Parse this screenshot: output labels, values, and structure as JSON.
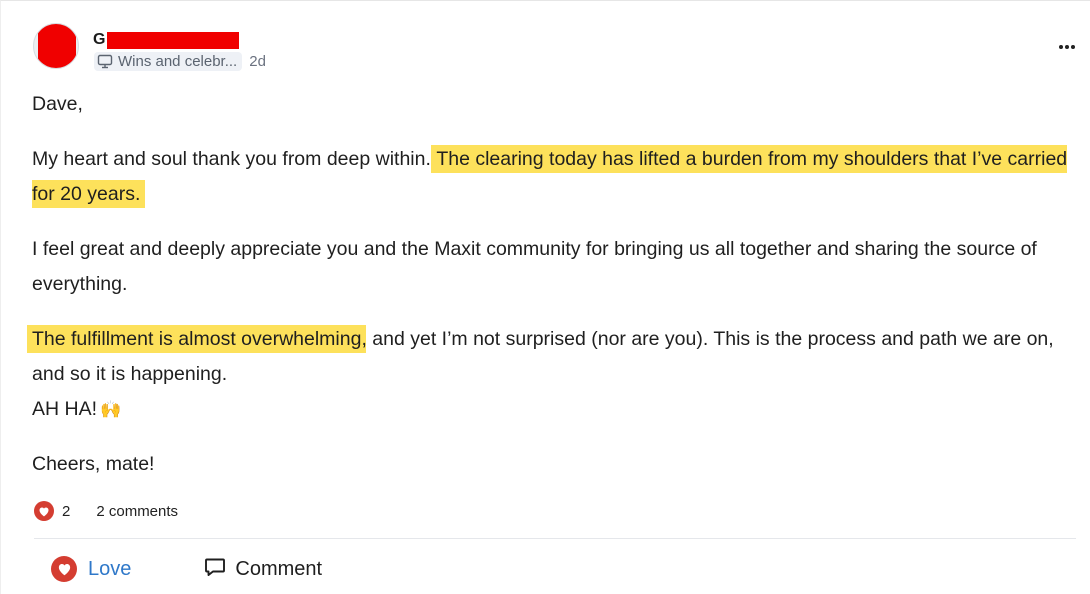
{
  "post": {
    "author_initial": "G",
    "category": "Wins and celebr...",
    "time": "2d",
    "greeting": "Dave,",
    "p1_plain": "My heart and soul thank you from deep within. ",
    "p1_highlight": "The clearing today has lifted a burden from my shoulders that I’ve carried for 20 years.",
    "p2": "I feel great and deeply appreciate you and the Maxit community for bringing us all together and sharing the source of everything.",
    "p3_highlight": "The fulfillment is almost overwhelming",
    "p3_plain": ", and yet I’m not surprised (nor are you). This is the process and path we are on, and so it is happening.",
    "p3_line2": "AH HA!",
    "p3_emoji": "🙌",
    "closing": "Cheers, mate!",
    "highlight_color": "#fde15b"
  },
  "stats": {
    "reactions_count": "2",
    "comments_label": "2 comments"
  },
  "actions": {
    "love_label": "Love",
    "comment_label": "Comment"
  },
  "colors": {
    "love": "#d43d31",
    "love_text": "#2f78c9",
    "redaction": "#f00000"
  },
  "icons": {
    "more": "more-horizontal-icon",
    "category": "monitor-icon",
    "reaction": "heart-icon",
    "comment": "speech-bubble-icon"
  }
}
